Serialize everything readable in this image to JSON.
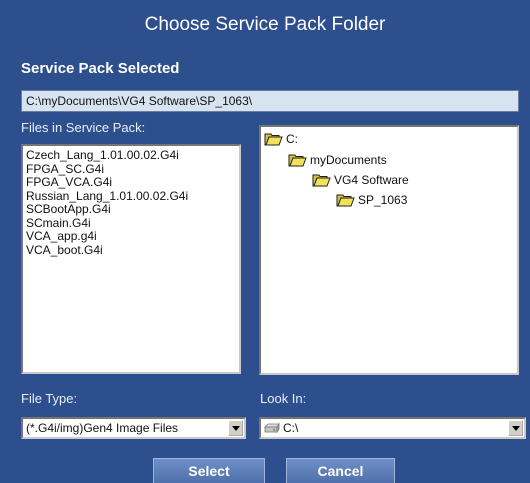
{
  "dialog": {
    "title": "Choose Service Pack Folder",
    "service_pack_label": "Service Pack Selected",
    "selected_path": "C:\\myDocuments\\VG4 Software\\SP_1063\\",
    "files_label": "Files in Service Pack:",
    "files": [
      "Czech_Lang_1.01.00.02.G4i",
      "FPGA_SC.G4i",
      "FPGA_VCA.G4i",
      "Russian_Lang_1.01.00.02.G4i",
      "SCBootApp.G4i",
      "SCmain.G4i",
      "VCA_app.g4i",
      "VCA_boot.G4i"
    ],
    "folder_tree": [
      {
        "label": "C:",
        "icon": "open-folder-icon"
      },
      {
        "label": "myDocuments",
        "icon": "open-folder-icon"
      },
      {
        "label": "VG4 Software",
        "icon": "open-folder-icon"
      },
      {
        "label": "SP_1063",
        "icon": "open-folder-icon"
      }
    ],
    "file_type_label": "File Type:",
    "file_type_value": "(*.G4i/img)Gen4 Image Files",
    "look_in_label": "Look In:",
    "look_in_value": "C:\\",
    "select_button": "Select",
    "cancel_button": "Cancel"
  },
  "colors": {
    "background": "#2d4f8d",
    "path_field": "#d8e3f2",
    "folder": "#f2e15a",
    "button": "#5b7cb8"
  }
}
